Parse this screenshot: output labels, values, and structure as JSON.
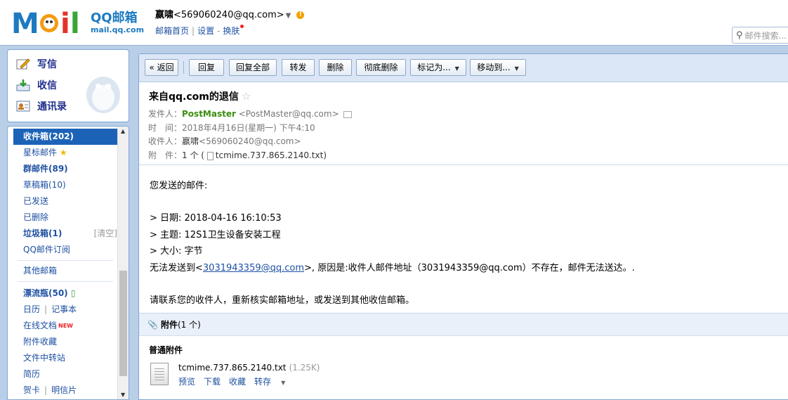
{
  "header": {
    "logo_text": "MOil",
    "brand_cn": "QQ邮箱",
    "brand_url": "mail.qq.com",
    "user_name": "嬴啸",
    "user_email": "<569060240@qq.com>",
    "links": [
      "邮箱首页",
      "设置",
      "换肤"
    ],
    "search_placeholder": "邮件搜索..."
  },
  "quick": [
    {
      "label": "写信",
      "icon": "compose-icon"
    },
    {
      "label": "收信",
      "icon": "inbox-download-icon"
    },
    {
      "label": "通讯录",
      "icon": "contacts-icon"
    }
  ],
  "folders": {
    "inbox": "收件箱(202)",
    "starred": "星标邮件",
    "group": "群邮件(89)",
    "drafts": "草稿箱(10)",
    "sent": "已发送",
    "deleted": "已删除",
    "spam": "垃圾箱(1)",
    "spam_clear": "[清空]",
    "subscriptions": "QQ邮件订阅",
    "other": "其他邮箱",
    "bottle": "漂流瓶(50)",
    "calendar": "日历",
    "notes": "记事本",
    "docs": "在线文档",
    "docs_badge": "NEW",
    "attach_fav": "附件收藏",
    "transfer": "文件中转站",
    "resume": "简历",
    "card": "贺卡",
    "postcard": "明信片"
  },
  "toolbar": {
    "back": "« 返回",
    "reply": "回复",
    "reply_all": "回复全部",
    "forward": "转发",
    "delete": "删除",
    "delete_perm": "彻底删除",
    "mark_as": "标记为...",
    "move_to": "移动到..."
  },
  "mail": {
    "subject": "来自qq.com的退信",
    "from_label": "发件人：",
    "from_name": "PostMaster",
    "from_addr": "<PostMaster@qq.com>",
    "time_label": "时　间：",
    "time": "2018年4月16日(星期一) 下午4:10",
    "to_label": "收件人：",
    "to_name": "嬴啸",
    "to_addr": "<569060240@qq.com>",
    "att_label": "附　件：",
    "att_count": "1 个 (",
    "att_file": "tcmime.737.865.2140.txt",
    "att_close": ")"
  },
  "body": {
    "l1": "您发送的邮件:",
    "l2": "> 日期: 2018-04-16 16:10:53",
    "l3": "> 主题: 12S1卫生设备安装工程",
    "l4": "> 大小: 字节",
    "l5a": "无法发送到<",
    "l5link": "3031943359@qq.com",
    "l5b": ">, 原因是:收件人邮件地址（3031943359@qq.com）不存在，邮件无法送达。.",
    "l6": "请联系您的收件人，重新核实邮箱地址，或发送到其他收信邮箱。"
  },
  "attachments": {
    "title": "附件",
    "count": "(1 个)",
    "section": "普通附件",
    "file_name": "tcmime.737.865.2140.txt",
    "file_size": "(1.25K)",
    "actions": [
      "预览",
      "下载",
      "收藏",
      "转存"
    ]
  }
}
